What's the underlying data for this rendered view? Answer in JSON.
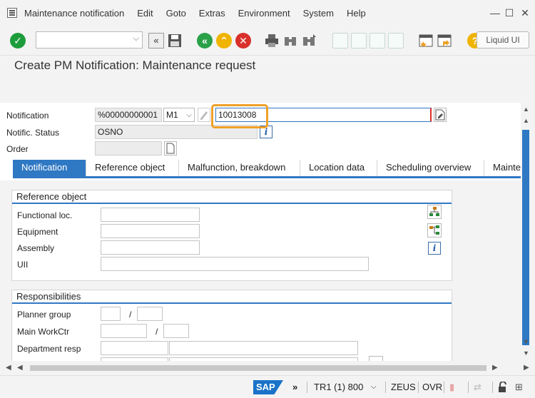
{
  "menu": {
    "items": [
      "Maintenance notification",
      "Edit",
      "Goto",
      "Extras",
      "Environment",
      "System",
      "Help"
    ]
  },
  "toolbar": {
    "command_value": "",
    "liquid_ui_label": "Liquid UI"
  },
  "page": {
    "title": "Create PM Notification: Maintenance request"
  },
  "header": {
    "notification_label": "Notification",
    "notification_type_value": "%00000000001",
    "notification_kind_value": "M1",
    "notification_number_value": "10013008",
    "status_label": "Notific. Status",
    "status_value": "OSNO",
    "order_label": "Order",
    "order_value": ""
  },
  "tabs": [
    {
      "label": "Notification",
      "active": true
    },
    {
      "label": "Reference object",
      "active": false
    },
    {
      "label": "Malfunction, breakdown",
      "active": false
    },
    {
      "label": "Location data",
      "active": false
    },
    {
      "label": "Scheduling overview",
      "active": false
    },
    {
      "label": "Mainte",
      "active": false
    }
  ],
  "reference_object": {
    "title": "Reference object",
    "functional_loc_label": "Functional loc.",
    "equipment_label": "Equipment",
    "assembly_label": "Assembly",
    "uii_label": "UII"
  },
  "responsibilities": {
    "title": "Responsibilities",
    "planner_group_label": "Planner group",
    "main_workctr_label": "Main WorkCtr",
    "department_resp_label": "Department resp",
    "slash": "/"
  },
  "statusbar": {
    "sap_label": "SAP",
    "system_info": "TR1 (1) 800",
    "server": "ZEUS",
    "mode": "OVR"
  },
  "colors": {
    "accent": "#2f78c3",
    "highlight": "#f0a028",
    "ok_green": "#1e9c3c",
    "nav_green": "#2aa148",
    "nav_yellow": "#f0b400",
    "cancel_red": "#d9302c"
  }
}
